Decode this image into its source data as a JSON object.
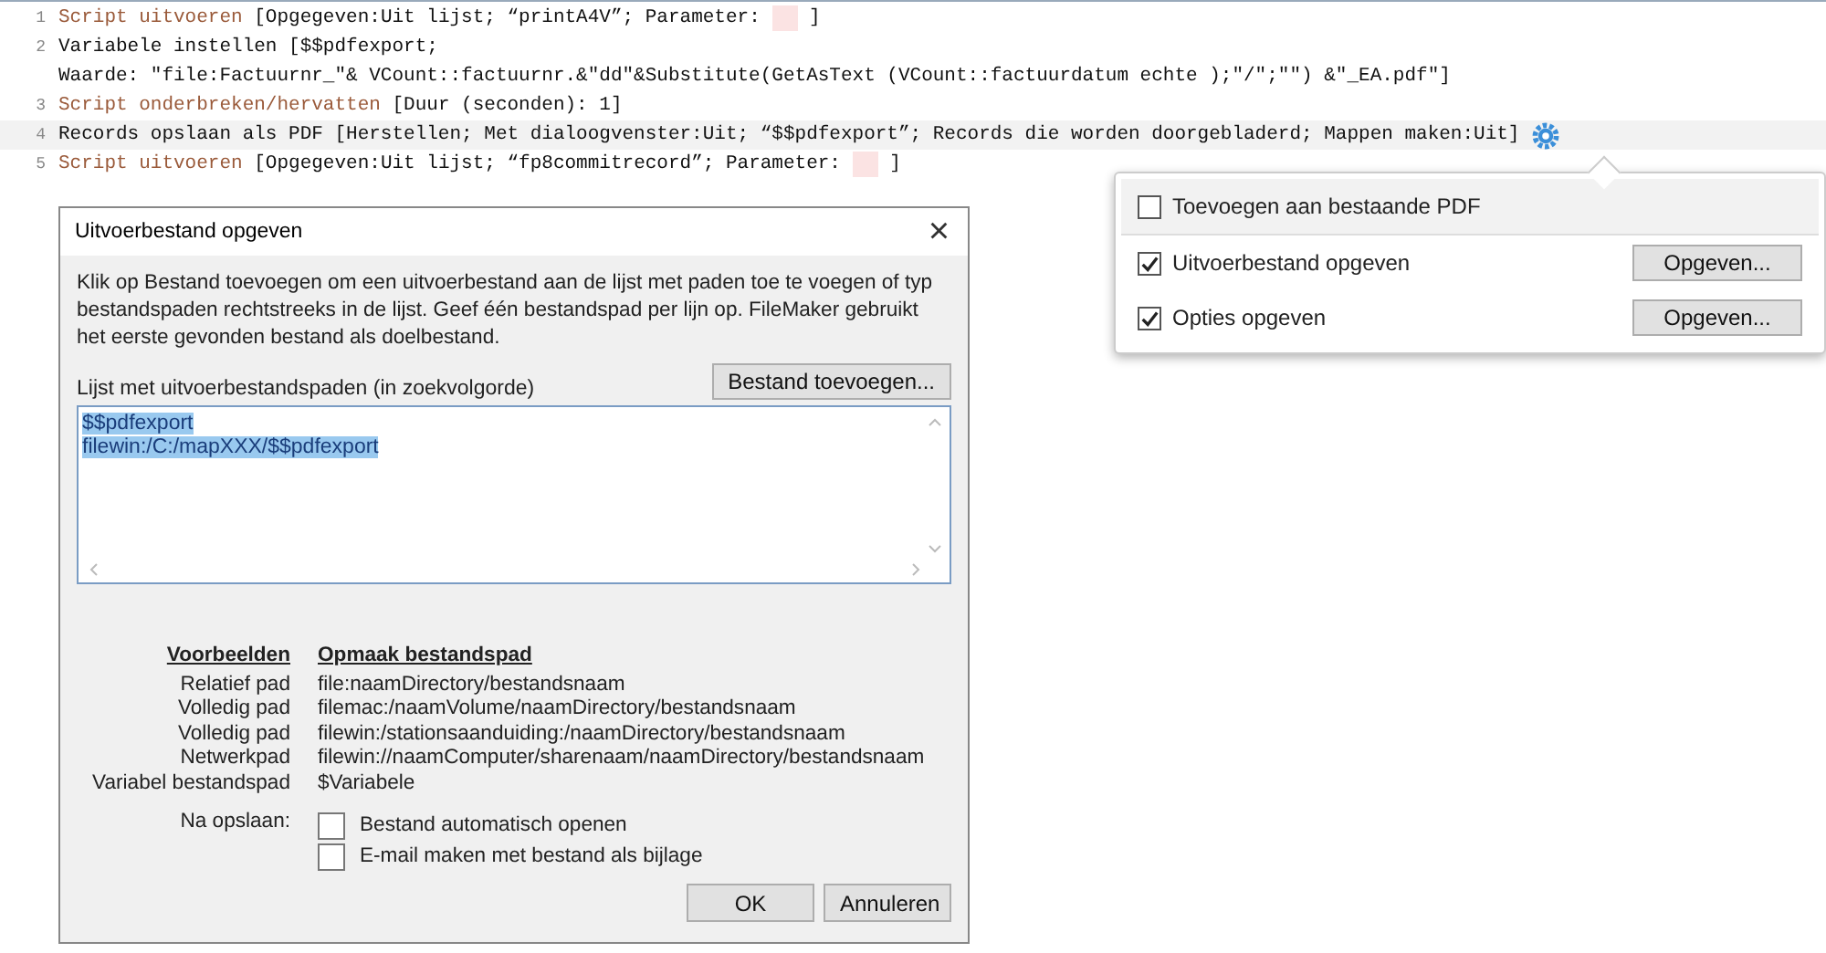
{
  "script_steps": [
    {
      "number": "1",
      "selected": false,
      "lines": [
        [
          {
            "kind": "step",
            "text": "Script uitvoeren"
          },
          {
            "kind": "args",
            "text": " [Opgegeven:Uit lijst; “printA4V”; Parameter: "
          },
          {
            "kind": "blank"
          },
          {
            "kind": "args",
            "text": " ]"
          }
        ]
      ]
    },
    {
      "number": "2",
      "selected": false,
      "lines": [
        [
          {
            "kind": "args",
            "text": "Variabele instellen [$$pdfexport;"
          }
        ],
        [
          {
            "kind": "args",
            "text": "Waarde: \"file:Factuurnr_\"& VCount::factuurnr.&\"dd\"&Substitute(GetAsText (VCount::factuurdatum echte );\"/\";\"\") &\"_EA.pdf\"]"
          }
        ]
      ]
    },
    {
      "number": "3",
      "selected": false,
      "lines": [
        [
          {
            "kind": "step",
            "text": "Script onderbreken/hervatten"
          },
          {
            "kind": "args",
            "text": " [Duur (seconden): 1]"
          }
        ]
      ]
    },
    {
      "number": "4",
      "selected": true,
      "lines": [
        [
          {
            "kind": "args",
            "text": "Records opslaan als PDF [Herstellen; Met dialoogvenster:Uit; “$$pdfexport”; Records die worden doorgebladerd; Mappen maken:Uit]"
          }
        ]
      ]
    },
    {
      "number": "5",
      "selected": false,
      "lines": [
        [
          {
            "kind": "step",
            "text": "Script uitvoeren"
          },
          {
            "kind": "args",
            "text": " [Opgegeven:Uit lijst; “fp8commitrecord”; Parameter: "
          },
          {
            "kind": "blank"
          },
          {
            "kind": "args",
            "text": " ]"
          }
        ]
      ]
    }
  ],
  "popover": {
    "rows": [
      {
        "kind": "plain",
        "label": "Toevoegen aan bestaande PDF",
        "checked": false
      },
      {
        "kind": "button",
        "label": "Uitvoerbestand opgeven",
        "checked": true,
        "button": "Opgeven..."
      },
      {
        "kind": "button",
        "label": "Opties opgeven",
        "checked": true,
        "button": "Opgeven..."
      }
    ]
  },
  "dialog": {
    "title": "Uitvoerbestand opgeven",
    "close": "×",
    "description": "Klik op Bestand toevoegen om een uitvoerbestand aan de lijst met paden toe te voegen of typ bestandspaden rechtstreeks in de lijst. Geef één bestandspad per lijn op. FileMaker gebruikt het eerste gevonden bestand als doelbestand.",
    "list_label": "Lijst met uitvoerbestandspaden (in zoekvolgorde)",
    "add_button": "Bestand toevoegen...",
    "paths": [
      {
        "text": "$$pdfexport ",
        "selected": true
      },
      {
        "text": "filewin:/C:/mapXXX/$$pdfexport",
        "selected": true
      }
    ],
    "examples": {
      "columns": [
        "Voorbeelden",
        "Opmaak bestandspad"
      ],
      "rows": [
        {
          "label": "Relatief pad",
          "value": "file:naamDirectory/bestandsnaam"
        },
        {
          "label": "Volledig pad",
          "value": "filemac:/naamVolume/naamDirectory/bestandsnaam"
        },
        {
          "label": "Volledig pad",
          "value": "filewin:/stationsaanduiding:/naamDirectory/bestandsnaam"
        },
        {
          "label": "Netwerkpad",
          "value": "filewin://naamComputer/sharenaam/naamDirectory/bestandsnaam"
        },
        {
          "label": "Variabel bestandspad",
          "value": "$Variabele"
        }
      ]
    },
    "after_save_label": "Na opslaan:",
    "after_save": [
      {
        "label": "Bestand automatisch openen",
        "checked": false
      },
      {
        "label": "E-mail maken met bestand als bijlage",
        "checked": false
      }
    ],
    "buttons": [
      "OK",
      "Annuleren"
    ]
  }
}
